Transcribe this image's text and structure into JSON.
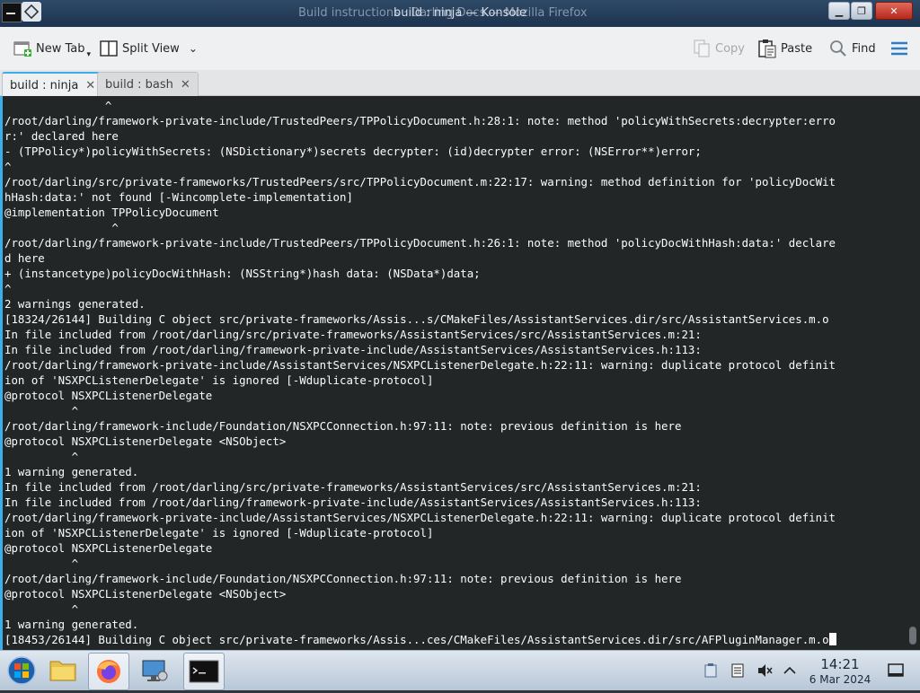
{
  "window": {
    "title": "build : ninja — Konsole",
    "ghost_title": "Build instructions · Darling Docs — Mozilla Firefox"
  },
  "toolbar": {
    "new_tab": "New Tab",
    "split_view": "Split View",
    "copy": "Copy",
    "paste": "Paste",
    "find": "Find"
  },
  "tabs": [
    {
      "label": "build : ninja",
      "close": "✕"
    },
    {
      "label": "build : bash",
      "close": "✕"
    }
  ],
  "terminal": {
    "lines": [
      "               ^",
      "/root/darling/framework-private-include/TrustedPeers/TPPolicyDocument.h:28:1: note: method 'policyWithSecrets:decrypter:erro",
      "r:' declared here",
      "- (TPPolicy*)policyWithSecrets: (NSDictionary*)secrets decrypter: (id)decrypter error: (NSError**)error;",
      "^",
      "/root/darling/src/private-frameworks/TrustedPeers/src/TPPolicyDocument.m:22:17: warning: method definition for 'policyDocWit",
      "hHash:data:' not found [-Wincomplete-implementation]",
      "@implementation TPPolicyDocument",
      "                ^",
      "/root/darling/framework-private-include/TrustedPeers/TPPolicyDocument.h:26:1: note: method 'policyDocWithHash:data:' declare",
      "d here",
      "+ (instancetype)policyDocWithHash: (NSString*)hash data: (NSData*)data;",
      "^",
      "2 warnings generated.",
      "[18324/26144] Building C object src/private-frameworks/Assis...s/CMakeFiles/AssistantServices.dir/src/AssistantServices.m.o",
      "In file included from /root/darling/src/private-frameworks/AssistantServices/src/AssistantServices.m:21:",
      "In file included from /root/darling/framework-private-include/AssistantServices/AssistantServices.h:113:",
      "/root/darling/framework-private-include/AssistantServices/NSXPCListenerDelegate.h:22:11: warning: duplicate protocol definit",
      "ion of 'NSXPCListenerDelegate' is ignored [-Wduplicate-protocol]",
      "@protocol NSXPCListenerDelegate",
      "          ^",
      "/root/darling/framework-include/Foundation/NSXPCConnection.h:97:11: note: previous definition is here",
      "@protocol NSXPCListenerDelegate <NSObject>",
      "          ^",
      "1 warning generated.",
      "In file included from /root/darling/src/private-frameworks/AssistantServices/src/AssistantServices.m:21:",
      "In file included from /root/darling/framework-private-include/AssistantServices/AssistantServices.h:113:",
      "/root/darling/framework-private-include/AssistantServices/NSXPCListenerDelegate.h:22:11: warning: duplicate protocol definit",
      "ion of 'NSXPCListenerDelegate' is ignored [-Wduplicate-protocol]",
      "@protocol NSXPCListenerDelegate",
      "          ^",
      "/root/darling/framework-include/Foundation/NSXPCConnection.h:97:11: note: previous definition is here",
      "@protocol NSXPCListenerDelegate <NSObject>",
      "          ^",
      "1 warning generated.",
      "[18453/26144] Building C object src/private-frameworks/Assis...ces/CMakeFiles/AssistantServices.dir/src/AFPluginManager.m.o"
    ]
  },
  "taskbar": {
    "time": "14:21",
    "date": "6 Mar 2024",
    "apps": [
      "start-orb",
      "file-manager",
      "firefox",
      "system-settings",
      "konsole"
    ]
  },
  "colors": {
    "terminal_bg": "#232627",
    "terminal_fg": "#fcfcfc",
    "accent": "#3daee9"
  }
}
